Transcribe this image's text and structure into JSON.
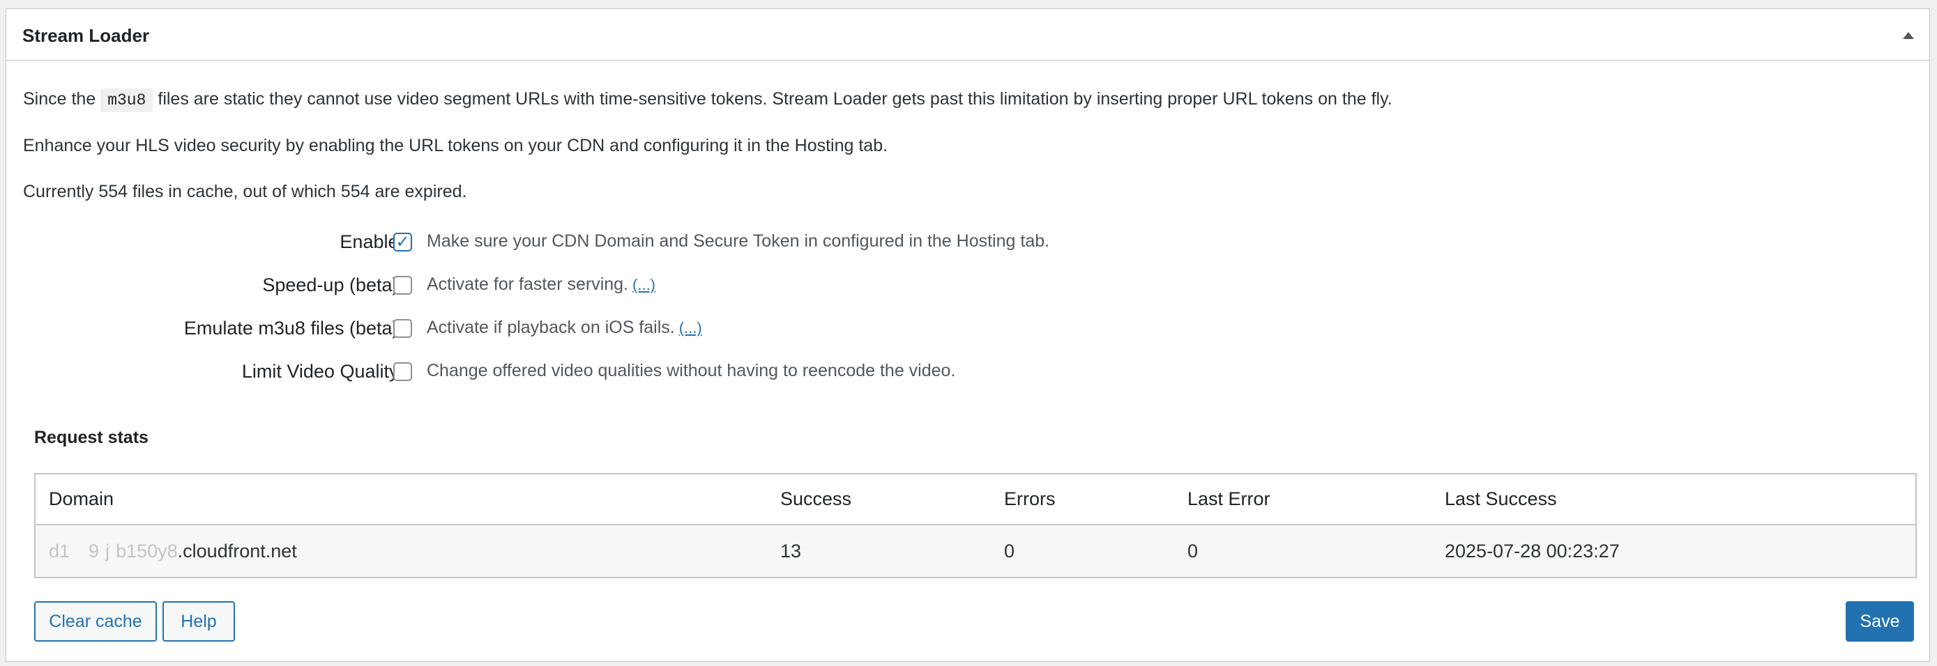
{
  "panel": {
    "title": "Stream Loader",
    "toggle_icon": "triangle-up-icon"
  },
  "intro": {
    "p1_before": "Since the",
    "p1_code": "m3u8",
    "p1_after": "files are static they cannot use video segment URLs with time-sensitive tokens. Stream Loader gets past this limitation by inserting proper URL tokens on the fly.",
    "p2": "Enhance your HLS video security by enabling the URL tokens on your CDN and configuring it in the Hosting tab.",
    "p3": "Currently 554 files in cache, out of which 554 are expired."
  },
  "settings": [
    {
      "label": "Enable:",
      "checked": true,
      "description": "Make sure your CDN Domain and Secure Token in configured in the Hosting tab.",
      "link": ""
    },
    {
      "label": "Speed-up (beta):",
      "checked": false,
      "description": "Activate for faster serving.",
      "link": "(...)"
    },
    {
      "label": "Emulate m3u8 files (beta):",
      "checked": false,
      "description": "Activate if playback on iOS fails.",
      "link": "(...)"
    },
    {
      "label": "Limit Video Quality:",
      "checked": false,
      "description": "Change offered video qualities without having to reencode the video.",
      "link": ""
    }
  ],
  "stats": {
    "title": "Request stats",
    "headers": [
      "Domain",
      "Success",
      "Errors",
      "Last Error",
      "Last Success"
    ],
    "rows": [
      {
        "domain": "d1...j.b150y8.cloudfront.net",
        "domain_visible": ".cloudfront.net",
        "domain_obscured": "d1   9 j b150y8",
        "success": "13",
        "errors": "0",
        "last_error": "0",
        "last_success": "2025-07-28 00:23:27"
      }
    ]
  },
  "buttons": {
    "clear_cache": "Clear cache",
    "help": "Help",
    "save": "Save"
  },
  "colors": {
    "accent": "#2271b1",
    "border": "#c3c4c7",
    "text": "#1d2327"
  }
}
